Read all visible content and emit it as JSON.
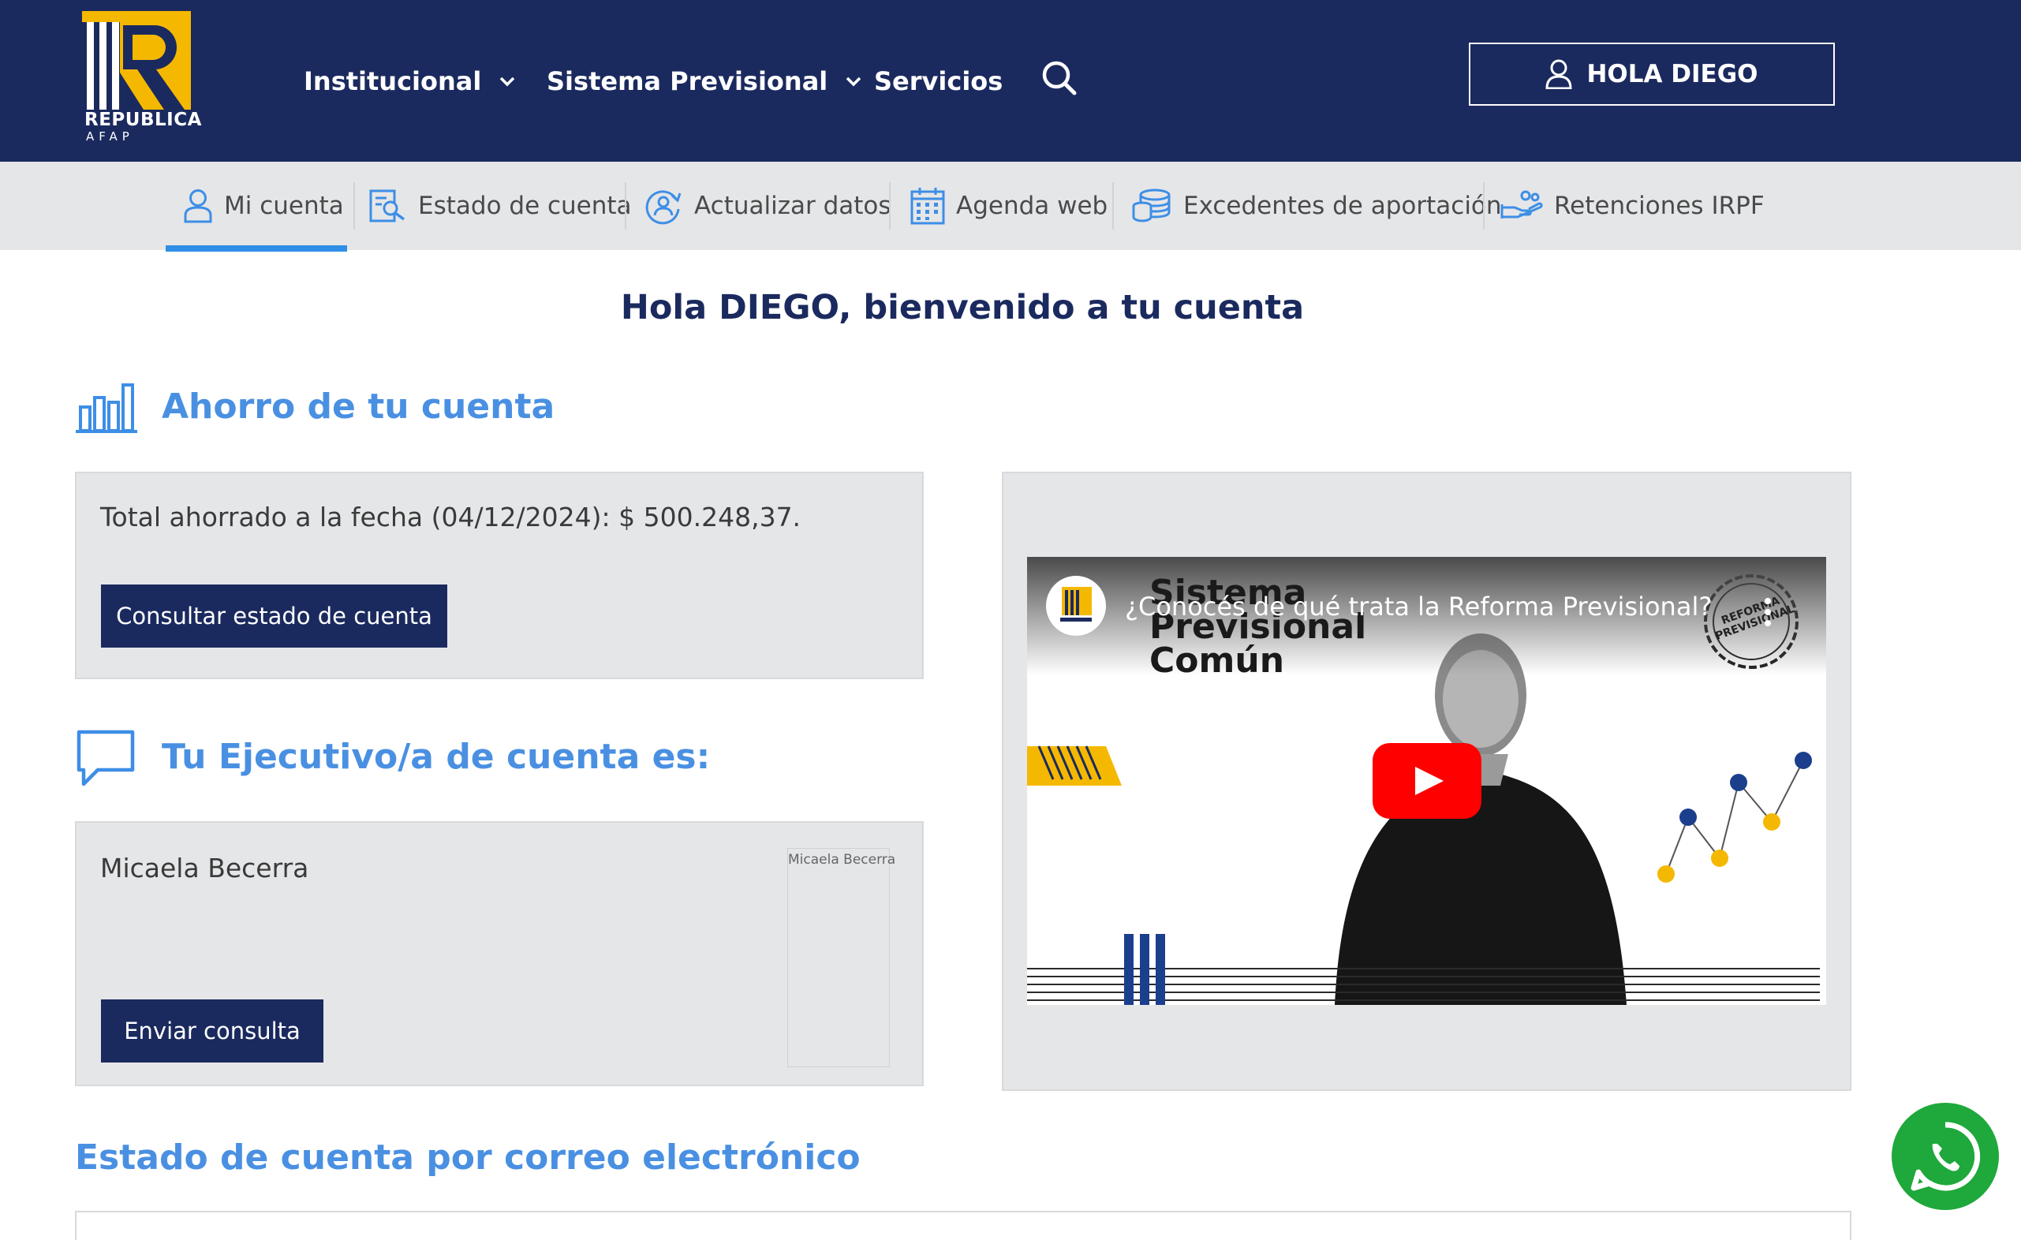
{
  "header": {
    "logo": {
      "name": "REPUBLICA",
      "sub": "AFAP"
    },
    "nav": [
      {
        "label": "Institucional",
        "has_dropdown": true
      },
      {
        "label": "Sistema Previsional",
        "has_dropdown": true
      },
      {
        "label": "Servicios",
        "has_dropdown": false
      }
    ],
    "search_icon": "search-icon",
    "user_button": "HOLA DIEGO"
  },
  "subnav": {
    "items": [
      {
        "label": "Mi cuenta",
        "icon": "user-icon",
        "active": true
      },
      {
        "label": "Estado de cuenta",
        "icon": "document-search-icon",
        "active": false
      },
      {
        "label": "Actualizar datos",
        "icon": "user-refresh-icon",
        "active": false
      },
      {
        "label": "Agenda web",
        "icon": "calendar-icon",
        "active": false
      },
      {
        "label": "Excedentes de aportación",
        "icon": "coins-icon",
        "active": false
      },
      {
        "label": "Retenciones IRPF",
        "icon": "hand-coins-icon",
        "active": false
      }
    ]
  },
  "welcome": "Hola DIEGO, bienvenido a tu cuenta",
  "savings": {
    "title": "Ahorro de tu cuenta",
    "total_text": "Total ahorrado a la fecha (04/12/2024): $ 500.248,37.",
    "button": "Consultar estado de cuenta"
  },
  "executive": {
    "title": "Tu Ejecutivo/a de cuenta es:",
    "name": "Micaela Becerra",
    "photo_alt": "Micaela Becerra",
    "button": "Enviar consulta"
  },
  "video": {
    "title": "¿Conocés de qué trata la Reforma Previsional?",
    "overlay_heading_1": "Sistema",
    "overlay_heading_2": "Previsional",
    "overlay_heading_3": "Común",
    "stamp_text": "REFORMA PREVISIONAL"
  },
  "email_section": {
    "title": "Estado de cuenta por correo electrónico"
  },
  "colors": {
    "navy": "#1b2a5e",
    "accent_blue": "#4a90e2",
    "active_tab": "#2f8fe6",
    "card_bg": "#e5e6e8",
    "logo_yellow": "#f5b800",
    "whatsapp_green": "#1fa83b"
  },
  "floating": {
    "whatsapp_icon": "whatsapp-icon"
  }
}
